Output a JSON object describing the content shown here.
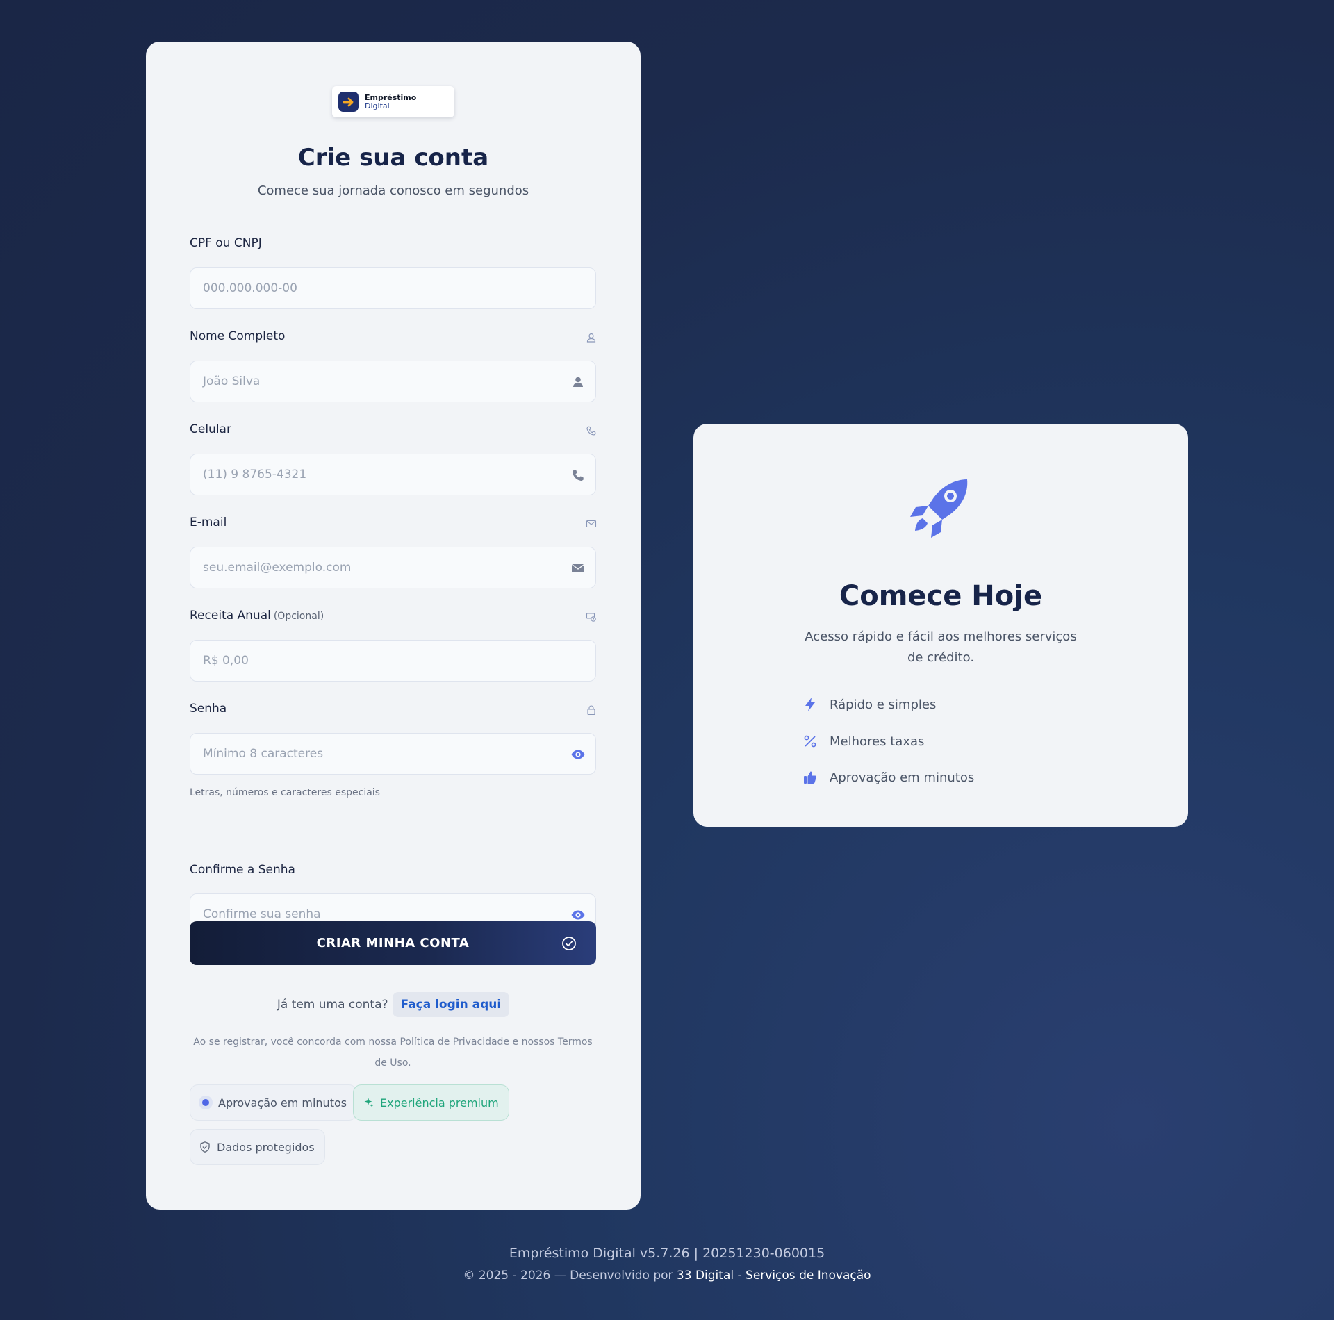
{
  "logo": {
    "line1": "Empréstimo",
    "line2": "Digital"
  },
  "form": {
    "title": "Crie sua conta",
    "subtitle": "Comece sua jornada conosco em segundos",
    "fields": {
      "document": {
        "label": "CPF ou CNPJ",
        "placeholder": "000.000.000-00"
      },
      "name": {
        "label": "Nome Completo",
        "placeholder": "João Silva"
      },
      "phone": {
        "label": "Celular",
        "placeholder": "(11) 9 8765-4321"
      },
      "email": {
        "label": "E-mail",
        "placeholder": "seu.email@exemplo.com"
      },
      "revenue": {
        "label": "Receita Anual",
        "optional": "(Opcional)",
        "placeholder": "R$ 0,00"
      },
      "password": {
        "label": "Senha",
        "placeholder": "Mínimo 8 caracteres",
        "hint": "Letras, números e caracteres especiais"
      },
      "confirm": {
        "label": "Confirme a Senha",
        "placeholder": "Confirme sua senha"
      }
    },
    "submit_label": "CRIAR MINHA CONTA",
    "login_prompt": "Já tem uma conta?",
    "login_link": "Faça login aqui",
    "terms": "Ao se registrar, você concorda com nossa Política de Privacidade e nossos Termos de Uso.",
    "badges": {
      "approval": "Aprovação em minutos",
      "premium": "Experiência premium",
      "protected": "Dados protegidos"
    }
  },
  "promo": {
    "title": "Comece Hoje",
    "description": "Acesso rápido e fácil aos melhores serviços de crédito.",
    "features": [
      {
        "icon": "bolt-icon",
        "label": "Rápido e simples"
      },
      {
        "icon": "percent-icon",
        "label": "Melhores taxas"
      },
      {
        "icon": "thumbs-up-icon",
        "label": "Aprovação em minutos"
      }
    ]
  },
  "footer": {
    "version": "Empréstimo Digital v5.7.26 | 20251230-060015",
    "copyright_prefix": "© 2025 - 2026 — Desenvolvido por",
    "company": "33 Digital - Serviços de Inovação"
  },
  "colors": {
    "accent": "#5b73e8",
    "brand_dark": "#172449",
    "link": "#1f5ccc",
    "success": "#1fa57b"
  }
}
